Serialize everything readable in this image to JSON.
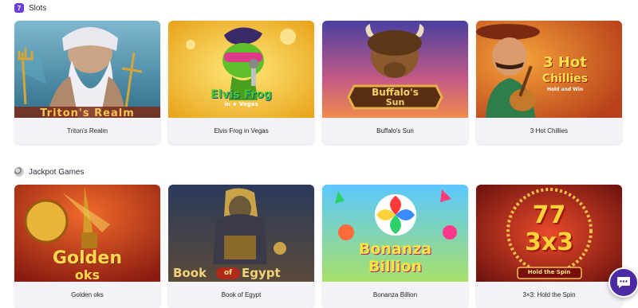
{
  "sections": {
    "slots": {
      "title": "Slots",
      "icon": "slots-icon",
      "games": [
        {
          "name": "Triton's Realm",
          "art_text": "Triton's Realm"
        },
        {
          "name": "Elvis Frog in Vegas",
          "art_text": "Elvis Frog",
          "art_sub": "in ★ Vegas"
        },
        {
          "name": "Buffalo's Sun",
          "art_text": "Buffalo's",
          "art_sub": "Sun"
        },
        {
          "name": "3 Hot Chillies",
          "art_text": "3 Hot",
          "art_sub": "Chillies",
          "art_caption": "Hold and Win"
        }
      ]
    },
    "jackpot": {
      "title": "Jackpot Games",
      "icon": "coin-icon",
      "games": [
        {
          "name": "Golden oks",
          "art_text": "Golden",
          "art_sub": "oks"
        },
        {
          "name": "Book of Egypt",
          "art_text": "Book",
          "art_mid": "of",
          "art_sub": "Egypt"
        },
        {
          "name": "Bonanza Billion",
          "art_text": "Bonanza",
          "art_sub": "Billion"
        },
        {
          "name": "3×3: Hold the Spin",
          "art_text": "77",
          "art_sub": "3x3",
          "art_caption": "Hold the Spin"
        }
      ]
    }
  },
  "chat": {
    "icon": "chat-bubble-icon"
  },
  "colors": {
    "accent": "#4b2aa3",
    "slots_icon": "#6b3fd6",
    "card_bg": "#f3f2f7"
  }
}
